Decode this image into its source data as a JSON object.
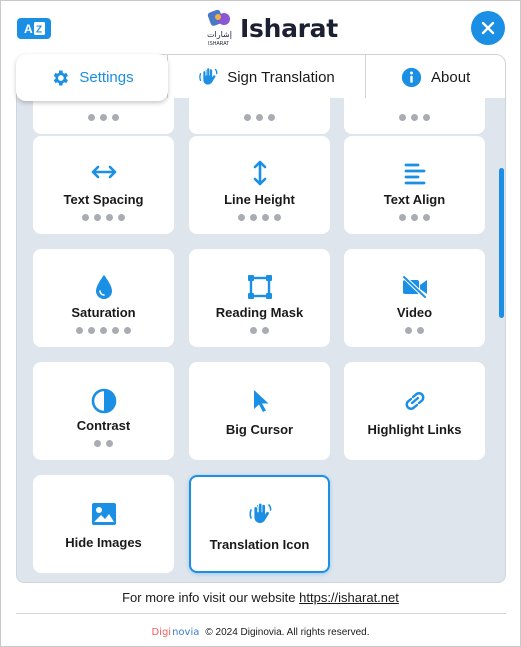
{
  "header": {
    "app_name": "Isharat",
    "logo_caption": "ISHARAT",
    "logo_arabic": "إشارات",
    "lang_icon": "translate-icon",
    "close_icon": "close-icon"
  },
  "tabs": [
    {
      "label": "Settings",
      "icon": "gear-icon",
      "active": true
    },
    {
      "label": "Sign Translation",
      "icon": "sign-hand-icon",
      "active": false
    },
    {
      "label": "About",
      "icon": "info-icon",
      "active": false
    }
  ],
  "cards": [
    {
      "label": "",
      "icon": "",
      "dots": 3
    },
    {
      "label": "",
      "icon": "",
      "dots": 3
    },
    {
      "label": "",
      "icon": "",
      "dots": 3
    },
    {
      "label": "Text Spacing",
      "icon": "arrows-horizontal-icon",
      "dots": 4
    },
    {
      "label": "Line Height",
      "icon": "arrows-vertical-icon",
      "dots": 4
    },
    {
      "label": "Text Align",
      "icon": "text-align-icon",
      "dots": 3
    },
    {
      "label": "Saturation",
      "icon": "droplet-icon",
      "dots": 5
    },
    {
      "label": "Reading Mask",
      "icon": "reading-mask-icon",
      "dots": 2
    },
    {
      "label": "Video",
      "icon": "video-off-icon",
      "dots": 2
    },
    {
      "label": "Contrast",
      "icon": "contrast-icon",
      "dots": 2
    },
    {
      "label": "Big Cursor",
      "icon": "cursor-icon",
      "dots": 0
    },
    {
      "label": "Highlight Links",
      "icon": "link-icon",
      "dots": 0
    },
    {
      "label": "Hide Images",
      "icon": "image-icon",
      "dots": 0
    },
    {
      "label": "Translation Icon",
      "icon": "sign-hand-icon",
      "dots": 0,
      "active": true
    }
  ],
  "footer": {
    "info_text": "For more info visit our website",
    "link_text": "https://isharat.net",
    "brand_a": "Digi",
    "brand_b": "novia",
    "copyright": "© 2024 Diginovia. All rights reserved."
  },
  "colors": {
    "accent": "#1a8fe3",
    "panel_bg": "#dfe5ec",
    "dot": "#a9adb3"
  }
}
